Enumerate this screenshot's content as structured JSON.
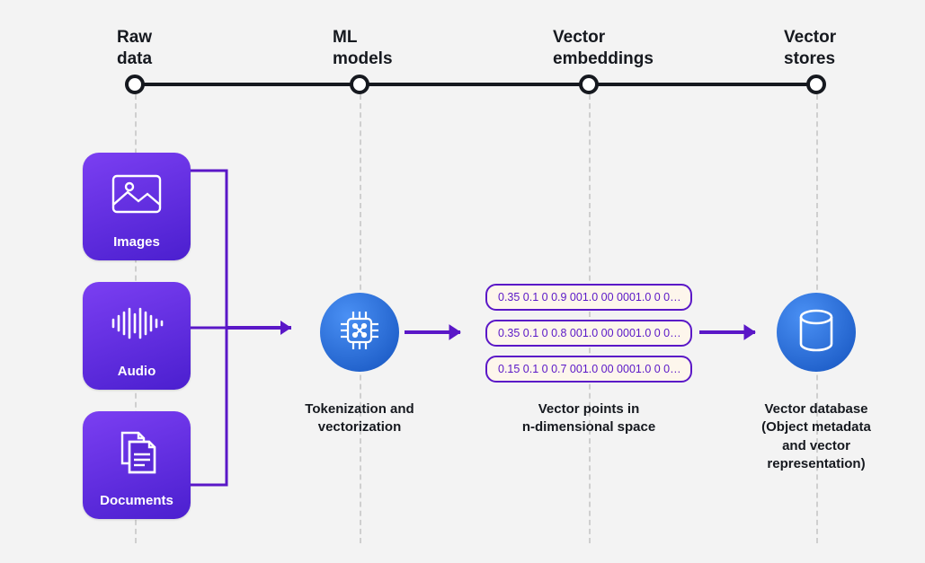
{
  "stages": {
    "raw": {
      "label_line1": "Raw",
      "label_line2": "data"
    },
    "ml": {
      "label_line1": "ML",
      "label_line2": "models"
    },
    "embed": {
      "label_line1": "Vector",
      "label_line2": "embeddings"
    },
    "store": {
      "label_line1": "Vector",
      "label_line2": "stores"
    }
  },
  "raw_cards": {
    "images": {
      "label": "Images"
    },
    "audio": {
      "label": "Audio"
    },
    "documents": {
      "label": "Documents"
    }
  },
  "ml_caption_line1": "Tokenization and",
  "ml_caption_line2": "vectorization",
  "vectors": {
    "v1": "0.35 0.1 0 0.9 001.0 00 0001.0 0 0…",
    "v2": "0.35 0.1 0 0.8 001.0 00 0001.0 0 0…",
    "v3": "0.15 0.1 0 0.7 001.0 00 0001.0 0 0…"
  },
  "embed_caption_line1": "Vector points in",
  "embed_caption_line2": "n-dimensional space",
  "store_caption_line1": "Vector database",
  "store_caption_line2": "(Object metadata",
  "store_caption_line3": "and vector",
  "store_caption_line4": "representation)",
  "colors": {
    "purple": "#5a17c7",
    "card_gradient_start": "#7b3ff2",
    "card_gradient_end": "#4b1fcf",
    "blue_gradient_start": "#4a90f4",
    "blue_gradient_end": "#1f5fc9",
    "pill_bg": "#fdf6ec"
  }
}
